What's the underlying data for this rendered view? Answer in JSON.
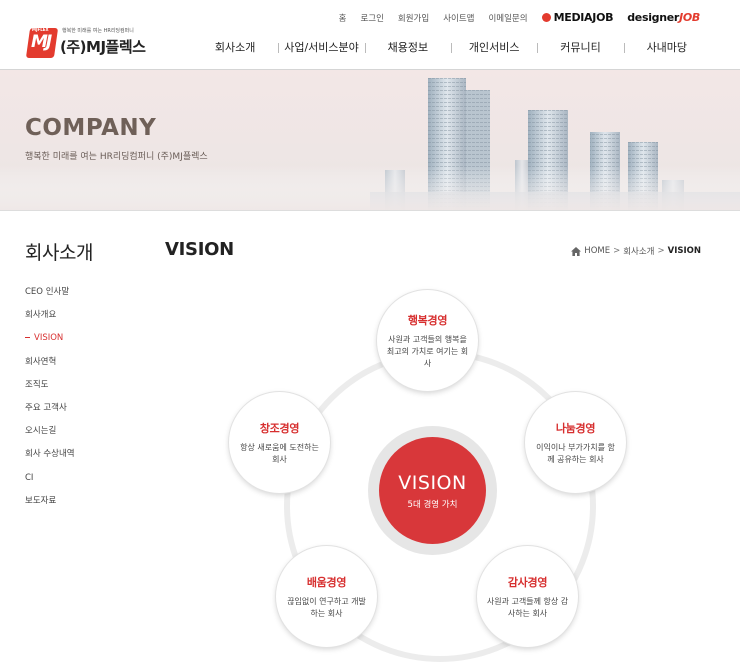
{
  "header": {
    "logo": {
      "mark": "MJ",
      "tiny": "MJFLEX",
      "slogan": "행복한 미래를 여는 HR리딩컴퍼니",
      "name": "(주)MJ플렉스"
    },
    "util_links": [
      "홈",
      "로그인",
      "회원가입",
      "사이트맵",
      "이메일문의"
    ],
    "mediajob_label": "MEDIAJOB",
    "designer_label_a": "designer",
    "designer_label_b": "JOB",
    "gnb": [
      "회사소개",
      "사업/서비스분야",
      "채용정보",
      "개인서비스",
      "커뮤니티",
      "사내마당"
    ]
  },
  "banner": {
    "title": "COMPANY",
    "subtitle": "행복한 미래를 여는 HR리딩컴퍼니 (주)MJ플렉스"
  },
  "sidebar": {
    "title": "회사소개",
    "items": [
      {
        "label": "CEO 인사말",
        "active": false
      },
      {
        "label": "회사개요",
        "active": false
      },
      {
        "label": "VISION",
        "active": true
      },
      {
        "label": "회사연혁",
        "active": false
      },
      {
        "label": "조직도",
        "active": false
      },
      {
        "label": "주요 고객사",
        "active": false
      },
      {
        "label": "오시는길",
        "active": false
      },
      {
        "label": "회사 수상내역",
        "active": false
      },
      {
        "label": "CI",
        "active": false
      },
      {
        "label": "보도자료",
        "active": false
      }
    ]
  },
  "content": {
    "page_title": "VISION",
    "breadcrumb": {
      "home": "HOME",
      "sep": ">",
      "parent": "회사소개",
      "current": "VISION"
    }
  },
  "vision": {
    "center_title": "VISION",
    "center_sub": "5대 경영 가치",
    "values": [
      {
        "title": "행복경영",
        "desc": "사원과 고객들의 행복을 최고의 가치로 여기는 회사"
      },
      {
        "title": "나눔경영",
        "desc": "이익이나 부가가치를 함께 공유하는 회사"
      },
      {
        "title": "창조경영",
        "desc": "항상 새로움에 도전하는 회사"
      },
      {
        "title": "배움경영",
        "desc": "끊임없이 연구하고 개발하는 회사"
      },
      {
        "title": "감사경영",
        "desc": "사원과 고객들께 항상 감사하는 회사"
      }
    ]
  },
  "colors": {
    "accent": "#d8373a",
    "banner_title": "#6f6058"
  }
}
